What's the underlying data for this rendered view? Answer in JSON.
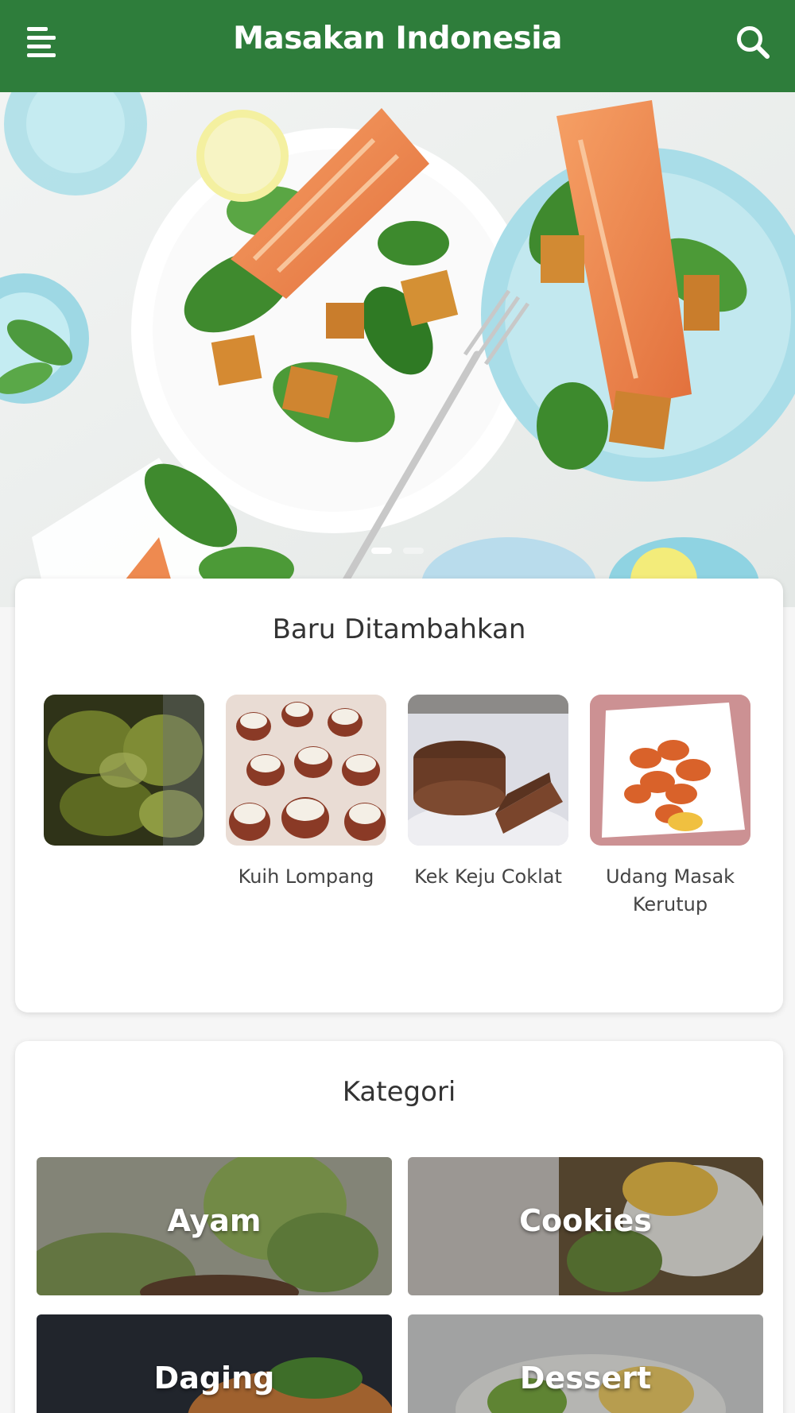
{
  "app_bar": {
    "title": "Masakan Indonesia",
    "background_color": "#2e7d3b",
    "menu_icon": "menu-icon",
    "search_icon": "search-icon"
  },
  "hero": {
    "image": "salmon-salad-photo",
    "slide_count": 2,
    "active_slide": 1
  },
  "recent": {
    "title": "Baru Ditambahkan",
    "items": [
      {
        "name": "",
        "image": "green-stew-photo"
      },
      {
        "name": "Kuih Lompang",
        "image": "kuih-lompang-photo"
      },
      {
        "name": "Kek Keju Coklat",
        "image": "chocolate-cake-photo"
      },
      {
        "name": "Udang Masak Kerutup",
        "image": "shrimp-dish-photo"
      }
    ]
  },
  "categories": {
    "title": "Kategori",
    "items": [
      {
        "label": "Ayam",
        "image": "chicken-burger-photo"
      },
      {
        "label": "Cookies",
        "image": "egg-toast-photo"
      },
      {
        "label": "Daging",
        "image": "meat-dish-photo"
      },
      {
        "label": "Dessert",
        "image": "dessert-plate-photo"
      }
    ]
  }
}
